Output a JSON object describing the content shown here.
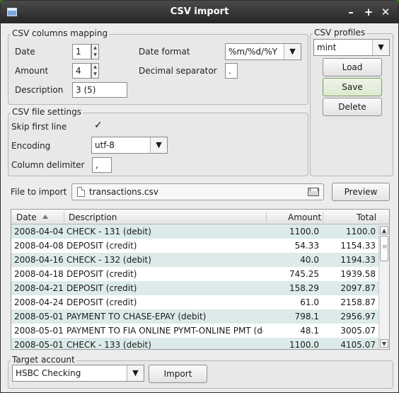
{
  "window": {
    "title": "CSV import",
    "min_glyph": "–",
    "max_glyph": "+",
    "close_glyph": "✕"
  },
  "mapping": {
    "title": "CSV columns mapping",
    "date_label": "Date",
    "date_value": "1",
    "amount_label": "Amount",
    "amount_value": "4",
    "description_label": "Description",
    "description_value": "3 (5)",
    "date_format_label": "Date format",
    "date_format_value": "%m/%d/%Y",
    "decimal_label": "Decimal separator",
    "decimal_value": "."
  },
  "profiles": {
    "title": "CSV profiles",
    "selected": "mint",
    "load_label": "Load",
    "save_label": "Save",
    "delete_label": "Delete"
  },
  "file_settings": {
    "title": "CSV file settings",
    "skip_label": "Skip first line",
    "skip_checked": "✓",
    "encoding_label": "Encoding",
    "encoding_value": "utf-8",
    "delimiter_label": "Column delimiter",
    "delimiter_value": ","
  },
  "file": {
    "label": "File to import",
    "name": "transactions.csv",
    "preview_label": "Preview"
  },
  "table": {
    "headers": {
      "date": "Date",
      "description": "Description",
      "amount": "Amount",
      "total": "Total"
    },
    "rows": [
      [
        "2008-04-04",
        "CHECK - 131 (debit)",
        "1100.0",
        "1100.0"
      ],
      [
        "2008-04-08",
        "DEPOSIT (credit)",
        "54.33",
        "1154.33"
      ],
      [
        "2008-04-16",
        "CHECK - 132 (debit)",
        "40.0",
        "1194.33"
      ],
      [
        "2008-04-18",
        "DEPOSIT (credit)",
        "745.25",
        "1939.58"
      ],
      [
        "2008-04-21",
        "DEPOSIT (credit)",
        "158.29",
        "2097.87"
      ],
      [
        "2008-04-24",
        "DEPOSIT (credit)",
        "61.0",
        "2158.87"
      ],
      [
        "2008-05-01",
        "PAYMENT TO CHASE-EPAY (debit)",
        "798.1",
        "2956.97"
      ],
      [
        "2008-05-01",
        "PAYMENT TO FIA ONLINE PYMT-ONLINE PMT (de...",
        "48.1",
        "3005.07"
      ],
      [
        "2008-05-01",
        "CHECK - 133 (debit)",
        "1100.0",
        "4105.07"
      ]
    ]
  },
  "target": {
    "title": "Target account",
    "account": "HSBC Checking",
    "import_label": "Import"
  }
}
